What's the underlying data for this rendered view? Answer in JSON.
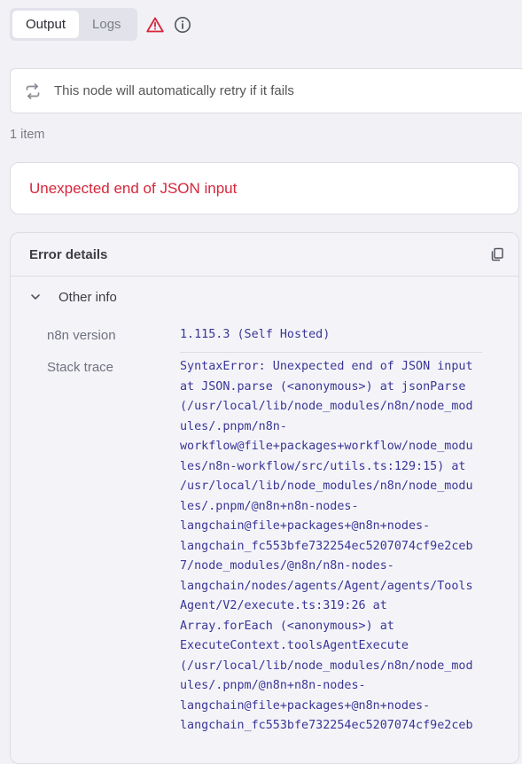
{
  "tabs": [
    {
      "label": "Output",
      "active": true
    },
    {
      "label": "Logs",
      "active": false
    }
  ],
  "icons": {
    "warning": "warning-triangle-icon",
    "info": "info-circle-icon",
    "retry": "retry-icon",
    "copy": "copy-icon",
    "chevron": "chevron-down-icon"
  },
  "notice": {
    "text": "This node will automatically retry if it fails"
  },
  "item_count": "1 item",
  "error": {
    "message": "Unexpected end of JSON input"
  },
  "details": {
    "title": "Error details",
    "section_label": "Other info",
    "version_label": "n8n version",
    "version_value": "1.115.3 (Self Hosted)",
    "stack_label": "Stack trace",
    "stack_lines": [
      "SyntaxError: Unexpected end of JSON input",
      "at JSON.parse (<anonymous>) at jsonParse",
      "(/usr/local/lib/node_modules/n8n/node_mod",
      "ules/.pnpm/n8n-",
      "workflow@file+packages+workflow/node_modu",
      "les/n8n-workflow/src/utils.ts:129:15) at",
      "/usr/local/lib/node_modules/n8n/node_modu",
      "les/.pnpm/@n8n+n8n-nodes-",
      "langchain@file+packages+@n8n+nodes-",
      "langchain_fc553bfe732254ec5207074cf9e2ceb",
      "7/node_modules/@n8n/n8n-nodes-",
      "langchain/nodes/agents/Agent/agents/Tools",
      "Agent/V2/execute.ts:319:26 at",
      "Array.forEach (<anonymous>) at",
      "ExecuteContext.toolsAgentExecute",
      "(/usr/local/lib/node_modules/n8n/node_mod",
      "ules/.pnpm/@n8n+n8n-nodes-",
      "langchain@file+packages+@n8n+nodes-",
      "langchain_fc553bfe732254ec5207074cf9e2ceb"
    ]
  },
  "colors": {
    "error": "#d7263b",
    "mono_text": "#3a3697",
    "background": "#f1f1f6"
  }
}
